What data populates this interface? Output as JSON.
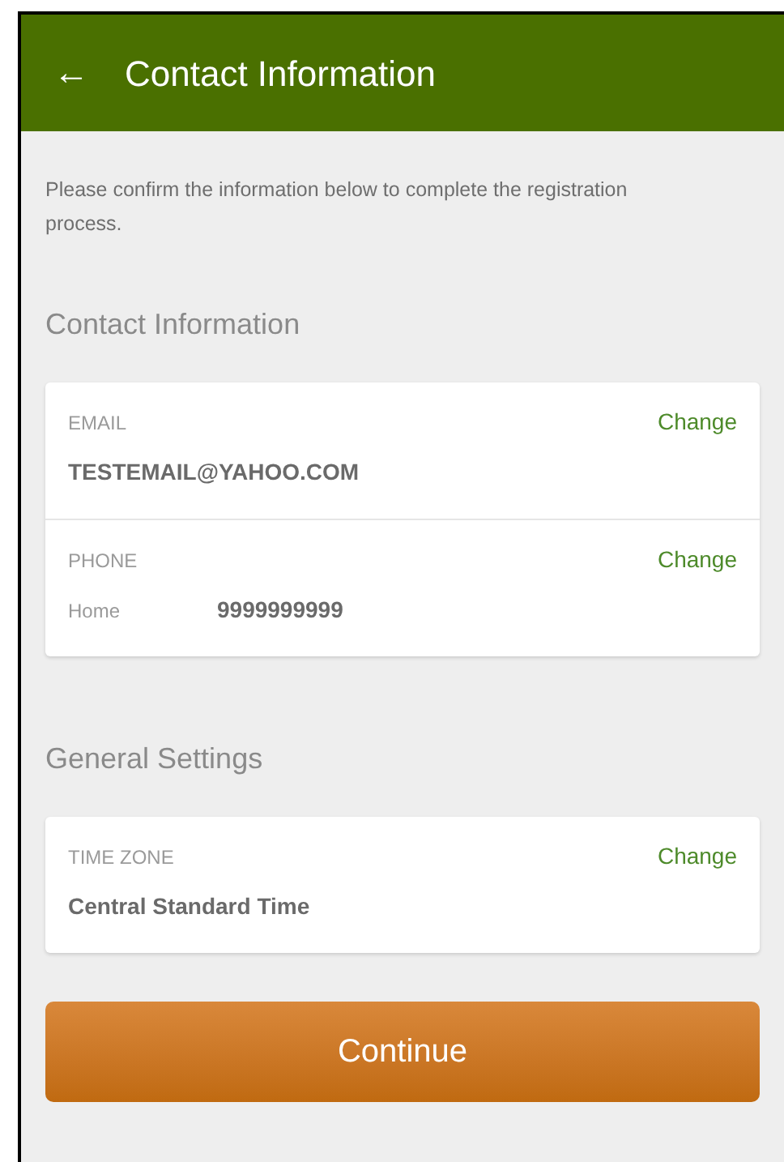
{
  "app_bar": {
    "back_icon": "←",
    "title": "Contact Information"
  },
  "intro": "Please confirm the information below to complete the registration process.",
  "sections": [
    {
      "heading": "Contact Information",
      "rows": [
        {
          "label": "EMAIL",
          "action": "Change",
          "value": "TESTEMAIL@YAHOO.COM"
        },
        {
          "label": "PHONE",
          "action": "Change",
          "type_label": "Home",
          "value": "9999999999"
        }
      ]
    },
    {
      "heading": "General Settings",
      "rows": [
        {
          "label": "TIME ZONE",
          "action": "Change",
          "value": "Central Standard Time"
        }
      ]
    }
  ],
  "continue_button": "Continue"
}
